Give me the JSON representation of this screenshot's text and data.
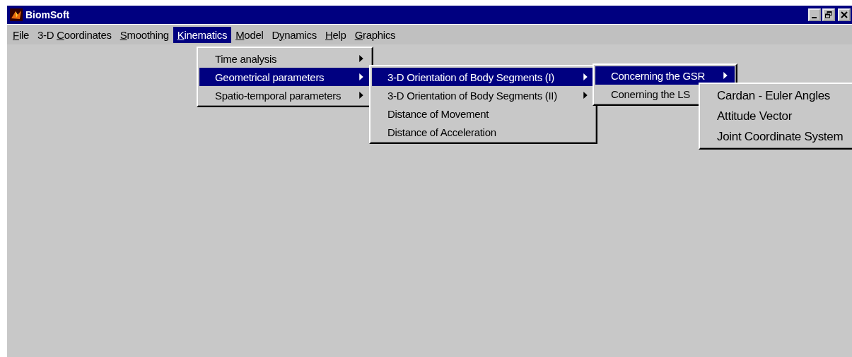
{
  "window": {
    "title": "BiomSoft"
  },
  "menu_bar": [
    {
      "mnemonic": "F",
      "after": "ile",
      "selected": false
    },
    {
      "before": "3-D ",
      "mnemonic": "C",
      "after": "oordinates",
      "selected": false
    },
    {
      "mnemonic": "S",
      "after": "moothing",
      "selected": false
    },
    {
      "mnemonic": "K",
      "after": "inematics",
      "selected": true
    },
    {
      "mnemonic": "M",
      "after": "odel",
      "selected": false
    },
    {
      "before": "D",
      "mnemonic": "y",
      "after": "namics",
      "selected": false
    },
    {
      "mnemonic": "H",
      "after": "elp",
      "selected": false
    },
    {
      "mnemonic": "G",
      "after": "raphics",
      "selected": false
    }
  ],
  "menus": [
    {
      "items": [
        {
          "label": "Time analysis",
          "has_submenu": true,
          "selected": false
        },
        {
          "label": "Geometrical parameters",
          "has_submenu": true,
          "selected": true
        },
        {
          "label": "Spatio-temporal parameters",
          "has_submenu": true,
          "selected": false
        }
      ]
    },
    {
      "items": [
        {
          "label": "3-D Orientation of Body Segments (I)",
          "has_submenu": true,
          "selected": true
        },
        {
          "label": "3-D Orientation of Body Segments (II)",
          "has_submenu": true,
          "selected": false
        },
        {
          "label": "Distance of Movement",
          "has_submenu": false,
          "selected": false
        },
        {
          "label": "Distance of Acceleration",
          "has_submenu": false,
          "selected": false
        }
      ]
    },
    {
      "items": [
        {
          "label": "Concerning the GSR",
          "has_submenu": true,
          "selected": true
        },
        {
          "label": "Conerning the LS",
          "has_submenu": false,
          "selected": false
        }
      ]
    },
    {
      "items": [
        {
          "label": "Cardan - Euler Angles",
          "has_submenu": false,
          "selected": false
        },
        {
          "label": "Attitude Vector",
          "has_submenu": false,
          "selected": false
        },
        {
          "label": "Joint Coordinate System",
          "has_submenu": false,
          "selected": false
        }
      ]
    }
  ]
}
